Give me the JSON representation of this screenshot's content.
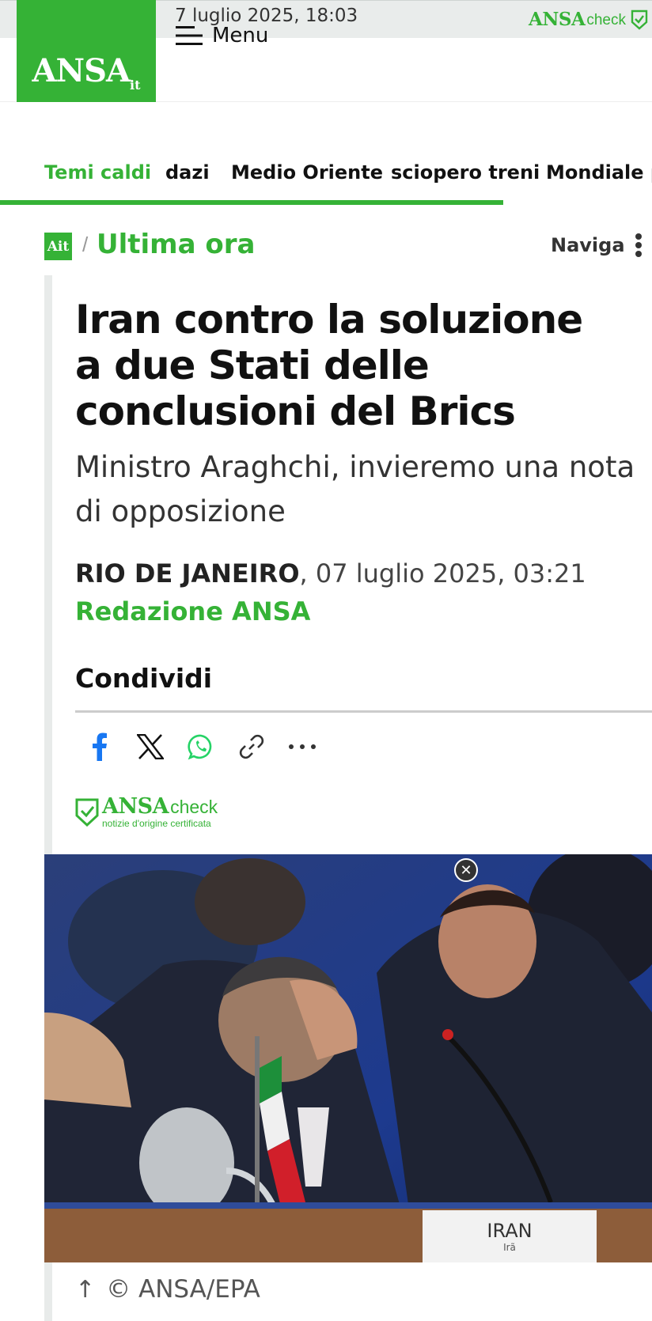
{
  "topbar": {
    "date": "7 luglio 2025, 18:03",
    "check_brand": "ANSA",
    "check_suffix": "check"
  },
  "header": {
    "logo_text": "ANSA",
    "logo_sup": "it",
    "menu_label": "Menu"
  },
  "topics": {
    "items": [
      {
        "label": "Temi caldi"
      },
      {
        "label": "dazi"
      },
      {
        "label": "Medio Oriente"
      },
      {
        "label": "sciopero treni"
      },
      {
        "label": "Mondiale pe"
      }
    ]
  },
  "section": {
    "icon_text": "Ait",
    "slash": "/",
    "title": "Ultima ora",
    "naviga": "Naviga"
  },
  "article": {
    "headline_lines": [
      "Iran contro la soluzione",
      "a due Stati delle",
      "conclusioni del Brics"
    ],
    "subhead_lines": [
      "Ministro Araghchi, invieremo una nota",
      "di opposizione"
    ],
    "place": "RIO DE JANEIRO",
    "date_rest": ", 07 luglio 2025, 03:21",
    "byline": "Redazione ANSA",
    "share_title": "Condividi",
    "ansacheck_brand": "ANSA",
    "ansacheck_suffix": "check",
    "ansacheck_tag": "notizie d'origine certificata",
    "photo_placard": "IRAN",
    "photo_placard_sub": "Irã",
    "caption": "© ANSA/EPA"
  },
  "colors": {
    "brand_green": "#35b236",
    "facebook": "#1877f2",
    "whatsapp": "#25d366"
  },
  "icons": [
    "menu-icon",
    "kebab-icon",
    "facebook-icon",
    "x-icon",
    "whatsapp-icon",
    "link-icon",
    "more-icon",
    "shield-check-icon",
    "close-icon",
    "arrow-up-icon"
  ]
}
